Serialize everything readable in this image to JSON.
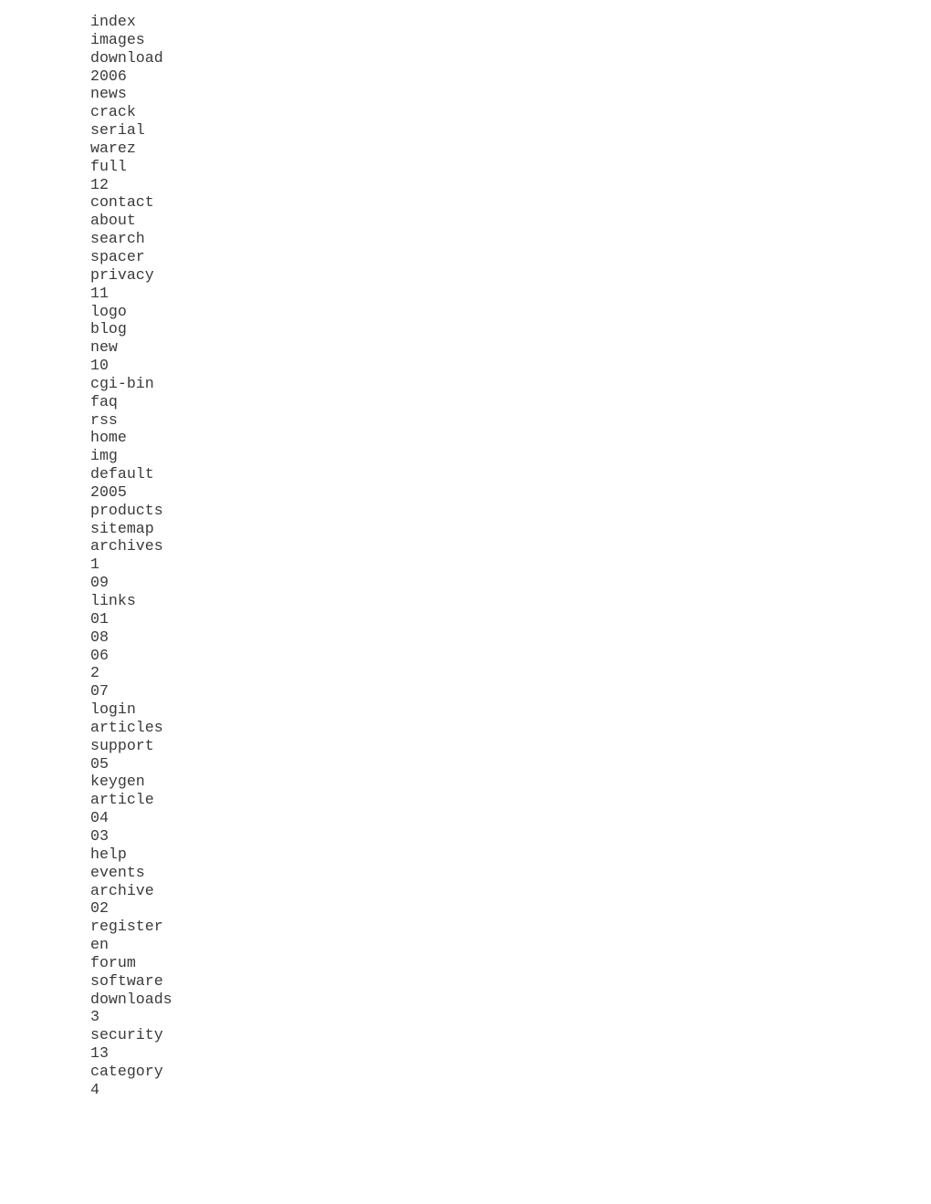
{
  "document": {
    "type": "plain-text-word-list",
    "background_color": "#ffffff",
    "text_color": "#3a3a3a",
    "lines": [
      "index",
      "images",
      "download",
      "2006",
      "news",
      "crack",
      "serial",
      "warez",
      "full",
      "12",
      "contact",
      "about",
      "search",
      "spacer",
      "privacy",
      "11",
      "logo",
      "blog",
      "new",
      "10",
      "cgi-bin",
      "faq",
      "rss",
      "home",
      "img",
      "default",
      "2005",
      "products",
      "sitemap",
      "archives",
      "1",
      "09",
      "links",
      "01",
      "08",
      "06",
      "2",
      "07",
      "login",
      "articles",
      "support",
      "05",
      "keygen",
      "article",
      "04",
      "03",
      "help",
      "events",
      "archive",
      "02",
      "register",
      "en",
      "forum",
      "software",
      "downloads",
      "3",
      "security",
      "13",
      "category",
      "4"
    ]
  }
}
